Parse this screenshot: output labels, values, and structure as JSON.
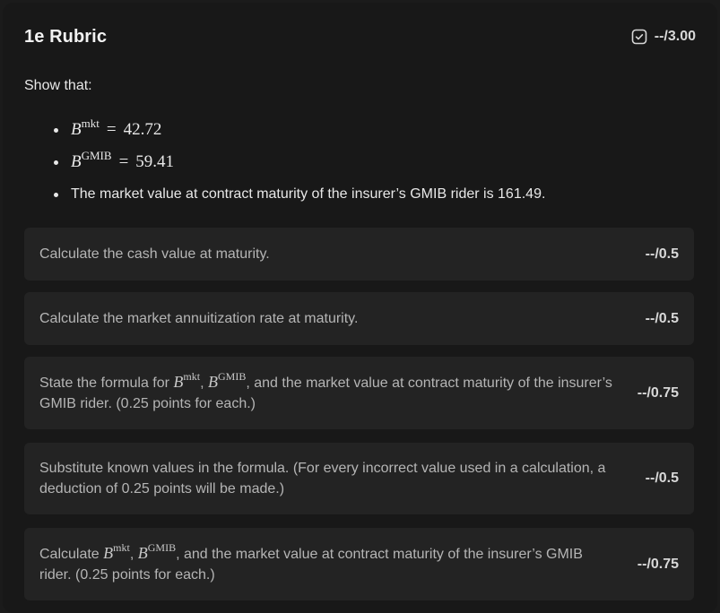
{
  "header": {
    "title": "1e Rubric",
    "total_score": "--/3.00"
  },
  "intro": "Show that:",
  "bullets": [
    {
      "symbol": "B",
      "superscript": "mkt",
      "equals": "=",
      "value": "42.72"
    },
    {
      "symbol": "B",
      "superscript": "GMIB",
      "equals": "=",
      "value": "59.41"
    },
    {
      "text": "The market value at contract maturity of the insurer’s GMIB rider is 161.49."
    }
  ],
  "rubric_items": [
    {
      "text": "Calculate the cash value at maturity.",
      "score": "--/0.5"
    },
    {
      "text": "Calculate the market annuitization rate at maturity.",
      "score": "--/0.5"
    },
    {
      "prefix": "State the formula for",
      "sym1": "B",
      "sup1": "mkt",
      "sep": ",",
      "sym2": "B",
      "sup2": "GMIB",
      "suffix": ", and the market value at contract maturity of the insurer’s GMIB rider. (0.25 points for each.)",
      "score": "--/0.75"
    },
    {
      "text": "Substitute known values in the formula. (For every incorrect value used in a calculation, a deduction of 0.25 points will be made.)",
      "score": "--/0.5"
    },
    {
      "prefix": "Calculate",
      "sym1": "B",
      "sup1": "mkt",
      "sep": ",",
      "sym2": "B",
      "sup2": "GMIB",
      "suffix": ", and the market value at contract maturity of the insurer’s GMIB rider. (0.25 points for each.)",
      "score": "--/0.75"
    }
  ]
}
